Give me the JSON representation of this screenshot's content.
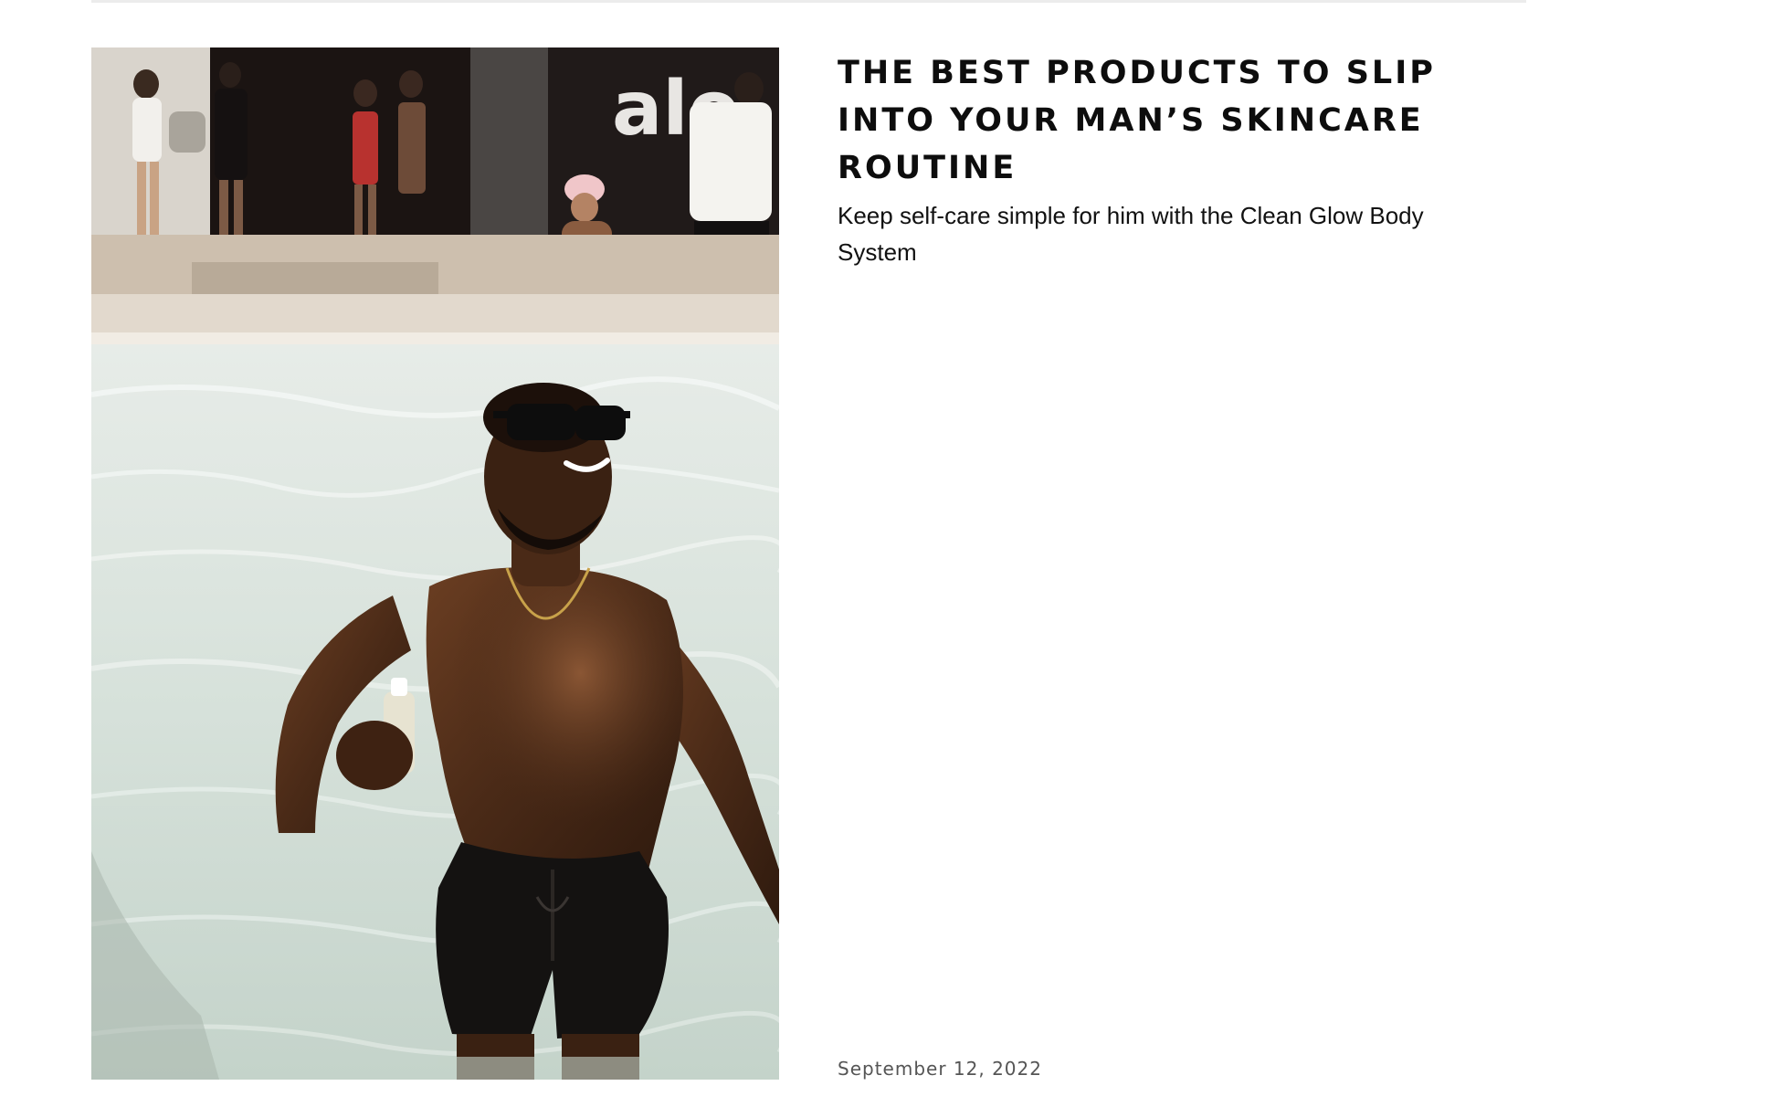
{
  "article": {
    "headline": "THE BEST PRODUCTS TO SLIP INTO YOUR MAN’S SKINCARE ROUTINE",
    "subtitle": "Keep self-care simple for him with the Clean Glow Body System",
    "date": "September 12, 2022",
    "image": {
      "storefront_logo_text": "alo"
    }
  },
  "colors": {
    "headline": "#0d0d0d",
    "body_text": "#111111",
    "date_text": "#555555",
    "divider": "#ececec"
  }
}
